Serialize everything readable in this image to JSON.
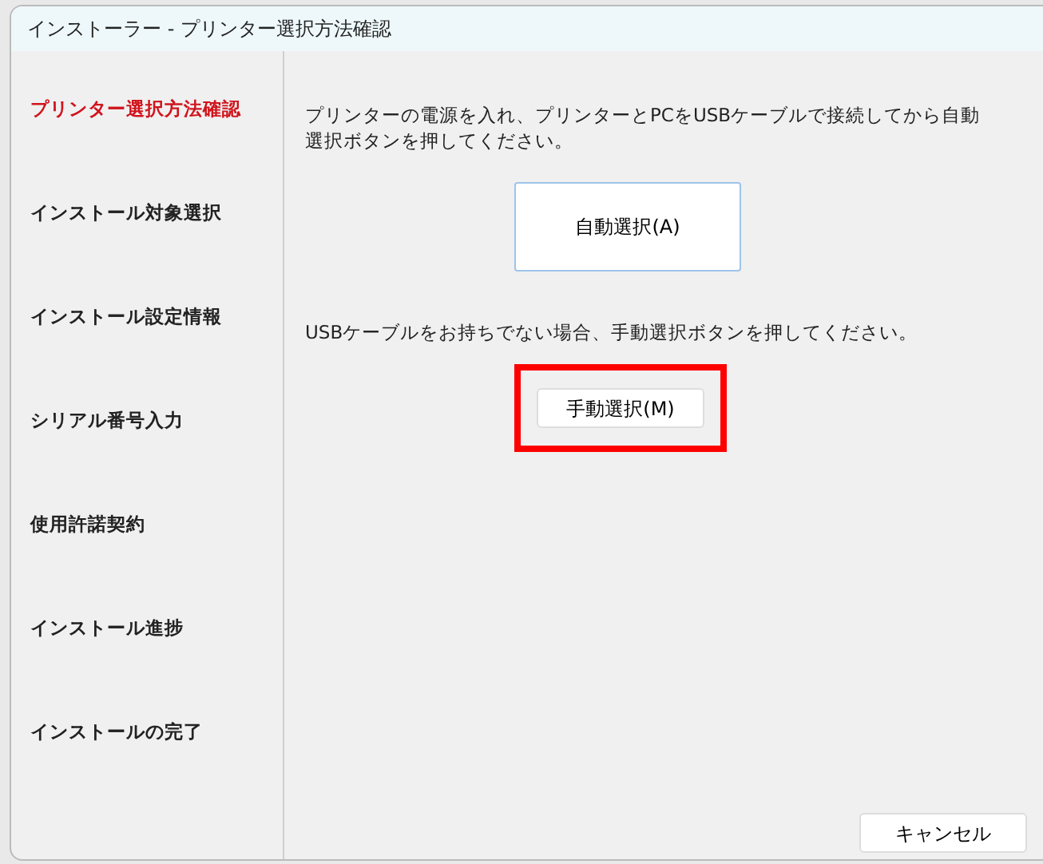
{
  "window": {
    "title": "インストーラー - プリンター選択方法確認"
  },
  "sidebar": {
    "items": [
      {
        "label": "プリンター選択方法確認",
        "selected": true
      },
      {
        "label": "インストール対象選択",
        "selected": false
      },
      {
        "label": "インストール設定情報",
        "selected": false
      },
      {
        "label": "シリアル番号入力",
        "selected": false
      },
      {
        "label": "使用許諾契約",
        "selected": false
      },
      {
        "label": "インストール進捗",
        "selected": false
      },
      {
        "label": "インストールの完了",
        "selected": false
      }
    ]
  },
  "content": [
    {
      "kind": "text",
      "text": "プリンターの電源を入れ、プリンターとPCをUSBケーブルで接続してから自動選択ボタンを押してください。"
    },
    {
      "kind": "large-button",
      "label": "自動選択(A)",
      "highlighted": false
    },
    {
      "kind": "text",
      "text": "USBケーブルをお持ちでない場合、手動選択ボタンを押してください。"
    },
    {
      "kind": "button",
      "label": "手動選択(M)",
      "highlighted": true
    }
  ],
  "footer": {
    "buttons": [
      "キャンセル"
    ]
  }
}
